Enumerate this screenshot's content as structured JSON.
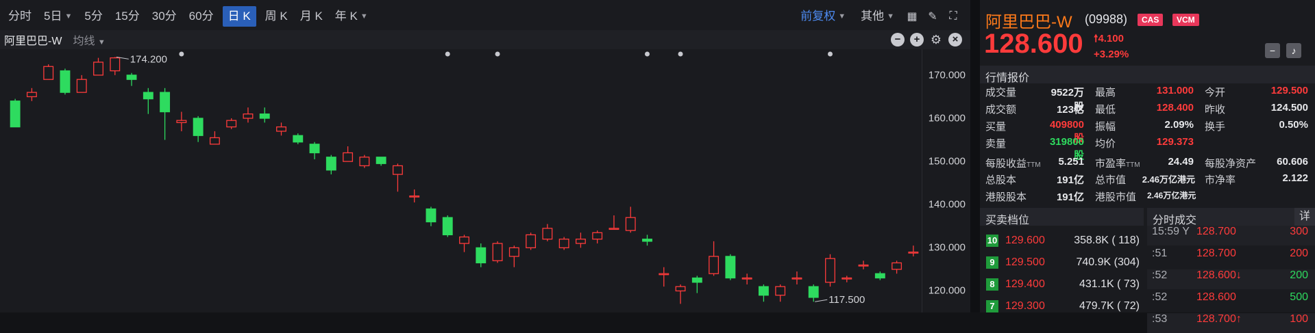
{
  "toolbar": {
    "periods": [
      "分时",
      "5日",
      "5分",
      "15分",
      "30分",
      "60分",
      "日 K",
      "周 K",
      "月 K",
      "年 K"
    ],
    "active": "日 K",
    "adjust": "前复权",
    "other": "其他"
  },
  "chart_header": {
    "name": "阿里巴巴-W",
    "ma": "均线"
  },
  "chart_data": {
    "type": "candlestick",
    "ylim": [
      115,
      176
    ],
    "y_ticks": [
      "170.000",
      "160.000",
      "150.000",
      "140.000",
      "130.000",
      "120.000"
    ],
    "y_tick_values": [
      170,
      160,
      150,
      140,
      130,
      120
    ],
    "high_label": "174.200",
    "low_label": "117.500",
    "candles": [
      [
        164,
        158,
        164.5,
        158
      ],
      [
        165,
        166,
        167,
        164
      ],
      [
        169,
        172,
        172.5,
        169
      ],
      [
        171,
        166,
        171.5,
        165.5
      ],
      [
        166,
        169,
        170,
        166
      ],
      [
        170,
        173,
        174,
        170
      ],
      [
        171,
        174,
        174.2,
        170
      ],
      [
        170,
        169,
        170.5,
        167.5
      ],
      [
        166,
        164.5,
        167,
        161
      ],
      [
        166,
        161.5,
        167,
        155
      ],
      [
        159,
        159.5,
        161.5,
        157
      ],
      [
        160,
        156,
        160.5,
        154.5
      ],
      [
        154,
        155.5,
        157,
        154
      ],
      [
        158,
        159.5,
        160,
        157.5
      ],
      [
        160,
        161,
        162.5,
        159
      ],
      [
        161,
        160,
        162.5,
        159
      ],
      [
        157,
        158,
        159,
        156
      ],
      [
        156,
        154.5,
        156.5,
        154
      ],
      [
        154,
        152,
        154.5,
        150.5
      ],
      [
        151,
        148,
        151.5,
        147
      ],
      [
        150,
        152,
        153.5,
        150
      ],
      [
        149,
        151,
        151.5,
        148.5
      ],
      [
        151,
        149.5,
        151,
        149
      ],
      [
        147,
        149,
        149.5,
        143
      ],
      [
        142,
        142,
        143.5,
        140.5
      ],
      [
        139,
        136,
        139.5,
        135
      ],
      [
        137,
        133,
        137.5,
        132.5
      ],
      [
        131,
        132.5,
        133,
        129
      ],
      [
        130,
        126.5,
        131,
        125.5
      ],
      [
        127,
        131,
        131.5,
        126.5
      ],
      [
        128,
        130,
        130.5,
        125.5
      ],
      [
        130,
        133,
        133.5,
        129.5
      ],
      [
        132,
        134.5,
        135.5,
        131.5
      ],
      [
        130,
        132,
        132.5,
        129.5
      ],
      [
        131,
        132,
        133.5,
        130
      ],
      [
        132,
        133.5,
        134,
        131
      ],
      [
        134.5,
        134.5,
        137.5,
        134.5
      ],
      [
        134,
        137,
        139.5,
        133.5
      ],
      [
        132,
        131.5,
        133,
        130.5
      ],
      [
        124,
        124,
        125.5,
        121
      ],
      [
        120,
        121,
        121.5,
        117
      ],
      [
        123,
        122,
        123.5,
        119.5
      ],
      [
        124,
        128,
        131.5,
        123.5
      ],
      [
        128,
        123,
        128.5,
        122.5
      ],
      [
        123,
        123,
        124,
        121.5
      ],
      [
        121,
        119,
        121.5,
        117.5
      ],
      [
        119,
        121,
        121.5,
        117.5
      ],
      [
        123,
        123,
        124.5,
        121.5
      ],
      [
        121,
        118.5,
        121.5,
        117.5
      ],
      [
        122,
        127.5,
        128.5,
        121
      ],
      [
        123,
        123,
        123.5,
        122
      ],
      [
        126,
        126,
        127,
        125
      ],
      [
        124,
        123,
        124.5,
        122.5
      ],
      [
        125,
        126.5,
        127,
        124
      ],
      [
        129,
        129,
        130.5,
        128
      ]
    ],
    "dot_markers": 6
  },
  "quote": {
    "name": "阿里巴巴-W",
    "code": "(09988)",
    "badges": [
      "CAS",
      "VCM"
    ],
    "price": "128.600",
    "change": "4.100",
    "change_pct": "+3.29%",
    "section_title": "行情报价",
    "rows": [
      [
        [
          "成交量",
          "9522万股",
          ""
        ],
        [
          "最高",
          "131.000",
          "red"
        ],
        [
          "今开",
          "129.500",
          "red"
        ]
      ],
      [
        [
          "成交额",
          "123亿",
          ""
        ],
        [
          "最低",
          "128.400",
          "red"
        ],
        [
          "昨收",
          "124.500",
          ""
        ]
      ],
      [
        [
          "买量",
          "409800股",
          "red"
        ],
        [
          "振幅",
          "2.09%",
          ""
        ],
        [
          "换手",
          "0.50%",
          ""
        ]
      ],
      [
        [
          "卖量",
          "319800股",
          "green"
        ],
        [
          "均价",
          "129.373",
          "red"
        ],
        [
          "",
          "",
          " "
        ]
      ]
    ],
    "eps_label": "每股收益",
    "eps_sub": "TTM",
    "eps": "5.251",
    "pe_label": "市盈率",
    "pe_sub": "TTM",
    "pe": "24.49",
    "bps_label": "每股净资产",
    "bps": "60.606",
    "shares_label": "总股本",
    "shares": "191亿",
    "mcap_label": "总市值",
    "mcap": "2.46万亿港元",
    "pb_label": "市净率",
    "pb": "2.122",
    "hk_shares_label": "港股股本",
    "hk_shares": "191亿",
    "hk_mcap_label": "港股市值",
    "hk_mcap": "2.46万亿港元"
  },
  "order_book": {
    "title": "买卖档位",
    "rows": [
      {
        "level": "10",
        "price": "129.600",
        "vol": "358.8K ( 118)"
      },
      {
        "level": "9",
        "price": "129.500",
        "vol": "740.9K (304)"
      },
      {
        "level": "8",
        "price": "129.400",
        "vol": "431.1K (  73)"
      },
      {
        "level": "7",
        "price": "129.300",
        "vol": "479.7K (  72)"
      }
    ]
  },
  "trades": {
    "title": "分时成交",
    "detail": "详",
    "rows": [
      {
        "time": "15:59  Y",
        "price": "128.700",
        "arrow": "",
        "vol": "300",
        "color": "red"
      },
      {
        "time": ":51",
        "price": "128.700",
        "arrow": "",
        "vol": "200",
        "color": "red"
      },
      {
        "time": ":52",
        "price": "128.600",
        "arrow": "↓",
        "vol": "200",
        "color": "green"
      },
      {
        "time": ":52",
        "price": "128.600",
        "arrow": "",
        "vol": "500",
        "color": "green"
      },
      {
        "time": ":53",
        "price": "128.700",
        "arrow": "↑",
        "vol": "100",
        "color": "red"
      }
    ]
  },
  "colors": {
    "up": "#ff3b3b",
    "down": "#2edb5f",
    "accent": "#2a5fb8",
    "brand": "#ff7a1a"
  }
}
